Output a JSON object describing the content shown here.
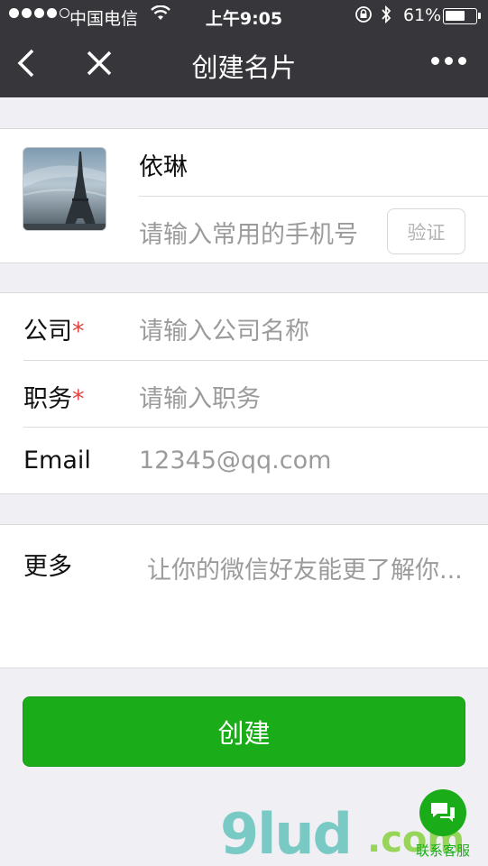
{
  "status_bar": {
    "carrier": "中国电信",
    "time": "上午9:05",
    "battery": "61%"
  },
  "nav": {
    "title": "创建名片"
  },
  "profile": {
    "name": "依琳",
    "phone_placeholder": "请输入常用的手机号",
    "verify_label": "验证"
  },
  "fields": {
    "company": {
      "label": "公司",
      "required_mark": "*",
      "placeholder": "请输入公司名称"
    },
    "position": {
      "label": "职务",
      "required_mark": "*",
      "placeholder": "请输入职务"
    },
    "email": {
      "label": "Email",
      "placeholder": "12345@qq.com"
    }
  },
  "more": {
    "label": "更多",
    "placeholder": "让你的微信好友能更了解你..."
  },
  "create_button": "创建",
  "watermark": {
    "logo": "9lud",
    "domain": ".com",
    "customer_service": "联系客服"
  },
  "colors": {
    "nav_bg": "#36363b",
    "primary_green": "#1aad19",
    "required_red": "#e64340"
  }
}
